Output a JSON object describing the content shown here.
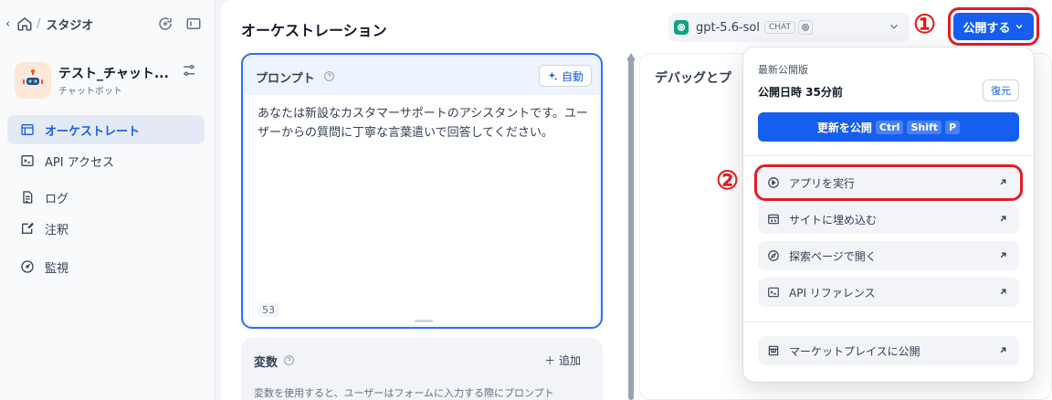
{
  "sidebar": {
    "breadcrumb": "スタジオ",
    "app": {
      "name": "テスト_チャット...",
      "type": "チャットボット"
    },
    "nav": [
      {
        "label": "オーケストレート",
        "active": true
      },
      {
        "label": "API アクセス"
      },
      {
        "label": "ログ"
      },
      {
        "label": "注釈"
      },
      {
        "label": "監視"
      }
    ]
  },
  "header": {
    "title": "オーケストレーション",
    "model": {
      "name": "gpt-5.6-sol",
      "badge": "CHAT"
    },
    "publish_label": "公開する"
  },
  "prompt": {
    "title": "プロンプト",
    "auto_label": "自動",
    "text": "あなたは新設なカスタマーサポートのアシスタントです。ユーザーからの質問に丁寧な言葉遣いで回答してください。",
    "char_count": "53"
  },
  "variables": {
    "title": "変数",
    "add_label": "追加",
    "description": "変数を使用すると、ユーザーはフォームに入力する際にプロンプト"
  },
  "debug": {
    "title": "デバッグとプ"
  },
  "dropdown": {
    "latest_label": "最新公開版",
    "published_time": "公開日時 35分前",
    "restore_label": "復元",
    "update_label": "更新を公開",
    "shortcut": [
      "Ctrl",
      "Shift",
      "P"
    ],
    "items": [
      {
        "label": "アプリを実行",
        "icon": "play-circle-icon"
      },
      {
        "label": "サイトに埋め込む",
        "icon": "embed-icon"
      },
      {
        "label": "探索ページで開く",
        "icon": "compass-icon"
      },
      {
        "label": "API リファレンス",
        "icon": "terminal-icon"
      },
      {
        "label": "マーケットプレイスに公開",
        "icon": "store-icon"
      }
    ]
  },
  "annotations": {
    "one": "①",
    "two": "②"
  },
  "colors": {
    "accent": "#155eef",
    "annotation": "#e11d25"
  }
}
